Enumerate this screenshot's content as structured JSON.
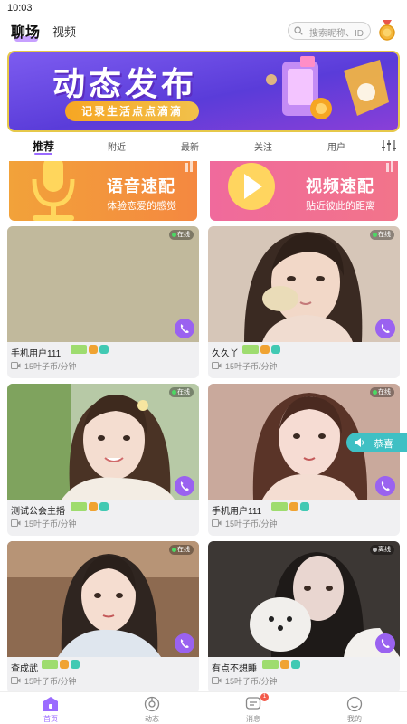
{
  "status_bar": {
    "time": "10:03"
  },
  "header": {
    "tab_active": "聊场",
    "tab_video": "视频",
    "search_placeholder": "搜索昵称、ID"
  },
  "banner": {
    "title": "动态发布",
    "subtitle": "记录生活点点滴滴"
  },
  "tabs": [
    "推荐",
    "附近",
    "最新",
    "关注",
    "用户"
  ],
  "features": [
    {
      "title": "语音速配",
      "subtitle": "体验恋爱的感觉"
    },
    {
      "title": "视频速配",
      "subtitle": "贴近彼此的距离"
    }
  ],
  "cards": [
    {
      "name": "手机用户111",
      "price": "15叶子币/分钟",
      "status": "在线"
    },
    {
      "name": "久久丫",
      "price": "15叶子币/分钟",
      "status": "在线"
    },
    {
      "name": "测试公会主播",
      "price": "15叶子币/分钟",
      "status": "在线"
    },
    {
      "name": "手机用户111",
      "price": "15叶子币/分钟",
      "status": "在线"
    },
    {
      "name": "查成武",
      "price": "15叶子币/分钟",
      "status": "在线"
    },
    {
      "name": "有点不想睡",
      "price": "15叶子币/分钟",
      "status": "离线"
    }
  ],
  "gift_tag": {
    "label": "恭喜"
  },
  "bottom_nav": [
    {
      "label": "首页",
      "icon": "home-icon",
      "active": true
    },
    {
      "label": "动态",
      "icon": "moments-icon",
      "active": false
    },
    {
      "label": "消息",
      "icon": "message-icon",
      "active": false,
      "badge": "1"
    },
    {
      "label": "我的",
      "icon": "profile-icon",
      "active": false
    }
  ],
  "colors": {
    "accent": "#9b6bff",
    "call_button": "#9a62f0",
    "online_dot": "#4cd964",
    "badge_red": "#f35a4a",
    "gift_tag": "#3fc0c4"
  }
}
